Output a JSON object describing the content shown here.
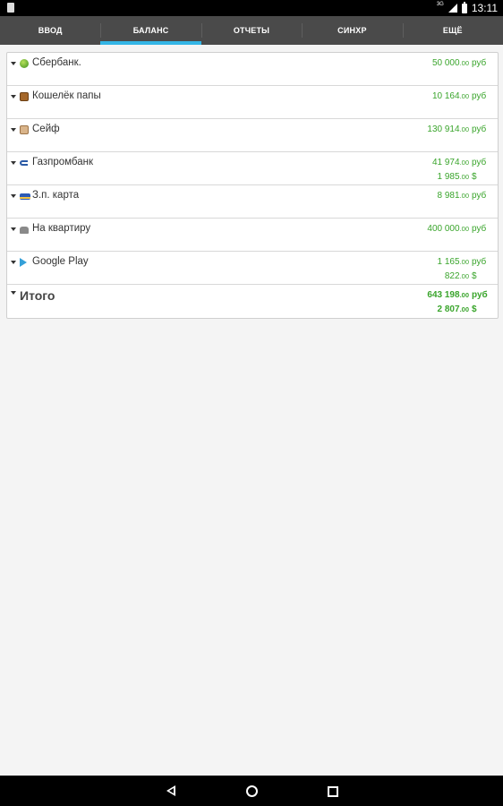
{
  "status_bar": {
    "network": "3G",
    "time": "13:11"
  },
  "tabs": [
    {
      "label": "ВВОД"
    },
    {
      "label": "БАЛАНС",
      "active": true
    },
    {
      "label": "ОТЧЕТЫ"
    },
    {
      "label": "СИНХР"
    },
    {
      "label": "ЕЩЁ"
    }
  ],
  "accounts": [
    {
      "name": "Сбербанк.",
      "icon": "sberbank-green-icon",
      "amounts": [
        {
          "int": "50 000",
          "dec": ".00",
          "cur": "руб"
        }
      ]
    },
    {
      "name": "Кошелёк папы",
      "icon": "wallet-icon",
      "amounts": [
        {
          "int": "10 164",
          "dec": ".00",
          "cur": "руб"
        }
      ]
    },
    {
      "name": "Сейф",
      "icon": "safe-icon",
      "amounts": [
        {
          "int": "130 914",
          "dec": ".00",
          "cur": "руб"
        }
      ]
    },
    {
      "name": "Газпромбанк",
      "icon": "gazprombank-icon",
      "amounts": [
        {
          "int": "41 974",
          "dec": ".00",
          "cur": "руб"
        },
        {
          "int": "1 985",
          "dec": ".00",
          "cur": "$"
        }
      ]
    },
    {
      "name": "З.п. карта",
      "icon": "visa-card-icon",
      "amounts": [
        {
          "int": "8 981",
          "dec": ".00",
          "cur": "руб"
        }
      ]
    },
    {
      "name": "На квартиру",
      "icon": "house-icon",
      "amounts": [
        {
          "int": "400 000",
          "dec": ".00",
          "cur": "руб"
        }
      ]
    },
    {
      "name": "Google Play",
      "icon": "google-play-icon",
      "amounts": [
        {
          "int": "1 165",
          "dec": ".00",
          "cur": "руб"
        },
        {
          "int": "822",
          "dec": ".00",
          "cur": "$"
        }
      ]
    }
  ],
  "total": {
    "name": "Итого",
    "amounts": [
      {
        "int": "643 198",
        "dec": ".00",
        "cur": "руб"
      },
      {
        "int": "2 807",
        "dec": ".00",
        "cur": "$"
      }
    ]
  },
  "colors": {
    "accent": "#33b5e5",
    "amount_green": "#3aa52c",
    "tabbar": "#4a4a4a"
  }
}
